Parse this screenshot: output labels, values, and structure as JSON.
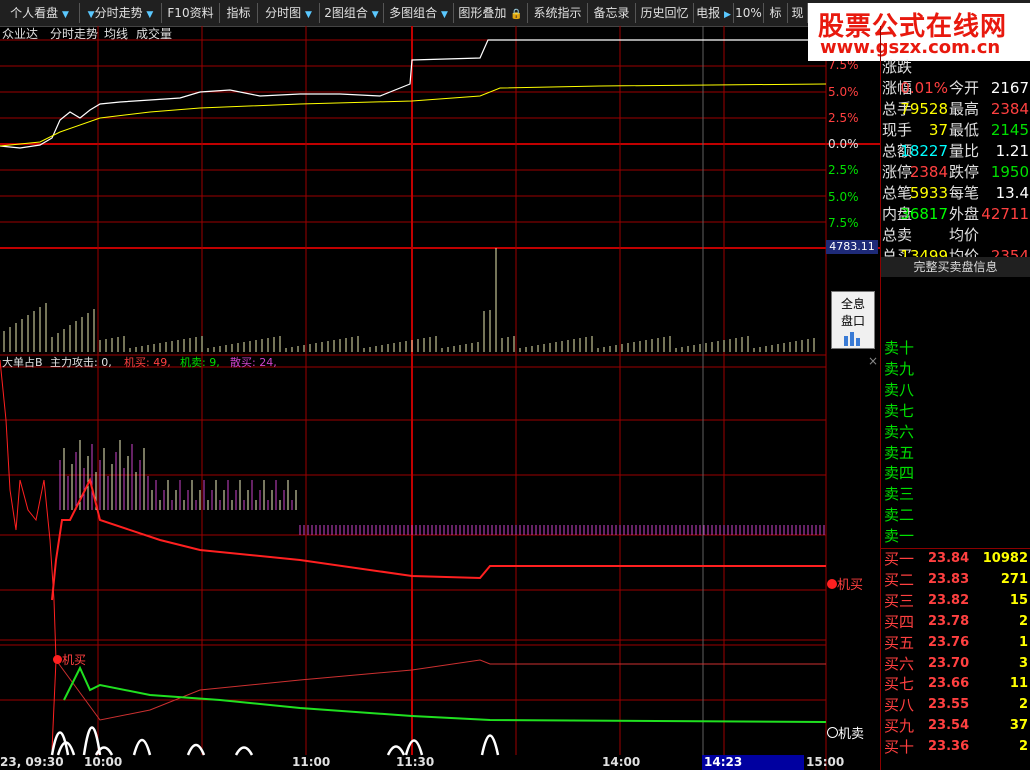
{
  "toolbar": {
    "items": [
      "个人看盘",
      "分时走势",
      "F10资料",
      "指标",
      "分时图",
      "2图组合",
      "多图组合",
      "图形叠加",
      "系统指示",
      "备忘录",
      "历史回忆",
      "电报",
      "10%",
      "标",
      "现"
    ]
  },
  "logo": {
    "title": "股票公式在线网",
    "url": "www.gszx.com.cn"
  },
  "chart": {
    "stock_name": "众业达",
    "title": "分时走势",
    "legend_avg": "均线",
    "legend_vol": "成交量",
    "pct_labels": [
      "7.5%",
      "5.0%",
      "2.5%",
      "0.0%",
      "2.5%",
      "5.0%",
      "7.5%"
    ],
    "price_tag": "4783.11",
    "indicator_label": "大单占B",
    "indicator_main": "主力攻击: 0,",
    "indicator_jimai": "机买: 49,",
    "indicator_jimaichu": "机卖: 9,",
    "indicator_sanmai": "散买: 24,",
    "marker_buy": "机买",
    "marker_buy_right": "机买",
    "marker_sell_right": "机卖",
    "close_x": "×"
  },
  "panel_button": {
    "line1": "全息",
    "line2": "盘口"
  },
  "time_axis": {
    "start": "23, 09:30",
    "t1": "10:00",
    "t2": "11:00",
    "t3": "11:30",
    "t4": "14:00",
    "cursor": "14:23",
    "end": "15:00"
  },
  "info": {
    "rows": [
      {
        "l1": "涨跌",
        "v1": "",
        "l2": "",
        "v2": ""
      },
      {
        "l1": "涨幅",
        "v1": "0.01%",
        "l2": "今开",
        "v2": "2167"
      },
      {
        "l1": "总手",
        "v1": "79528",
        "l2": "最高",
        "v2": "2384"
      },
      {
        "l1": "现手",
        "v1": "37",
        "l2": "最低",
        "v2": "2145"
      },
      {
        "l1": "总额",
        "v1": "18227",
        "l2": "量比",
        "v2": "1.21"
      },
      {
        "l1": "涨停",
        "v1": "2384",
        "l2": "跌停",
        "v2": "1950"
      },
      {
        "l1": "总笔",
        "v1": "5933",
        "l2": "每笔",
        "v2": "13.4"
      },
      {
        "l1": "内盘",
        "v1": "36817",
        "l2": "外盘",
        "v2": "42711"
      },
      {
        "l1": "总卖",
        "v1": "",
        "l2": "均价",
        "v2": ""
      },
      {
        "l1": "总买",
        "v1": "13499",
        "l2": "均价",
        "v2": "2354"
      }
    ],
    "detail_button": "完整买卖盘信息"
  },
  "orderbook": {
    "asks": [
      "卖十",
      "卖九",
      "卖八",
      "卖七",
      "卖六",
      "卖五",
      "卖四",
      "卖三",
      "卖二",
      "卖一"
    ],
    "bids": [
      {
        "label": "买一",
        "price": "23.84",
        "vol": "10982"
      },
      {
        "label": "买二",
        "price": "23.83",
        "vol": "271"
      },
      {
        "label": "买三",
        "price": "23.82",
        "vol": "15"
      },
      {
        "label": "买四",
        "price": "23.78",
        "vol": "2"
      },
      {
        "label": "买五",
        "price": "23.76",
        "vol": "1"
      },
      {
        "label": "买六",
        "price": "23.70",
        "vol": "3"
      },
      {
        "label": "买七",
        "price": "23.66",
        "vol": "11"
      },
      {
        "label": "买八",
        "price": "23.55",
        "vol": "2"
      },
      {
        "label": "买九",
        "price": "23.54",
        "vol": "37"
      },
      {
        "label": "买十",
        "price": "23.36",
        "vol": "2"
      }
    ]
  },
  "colors": {
    "up": "#ff4040",
    "down": "#00e000",
    "grid": "#9b0000",
    "yellow": "#ffff00",
    "cyan": "#00ffff",
    "purple": "#cc44cc",
    "white": "#ffffff"
  }
}
